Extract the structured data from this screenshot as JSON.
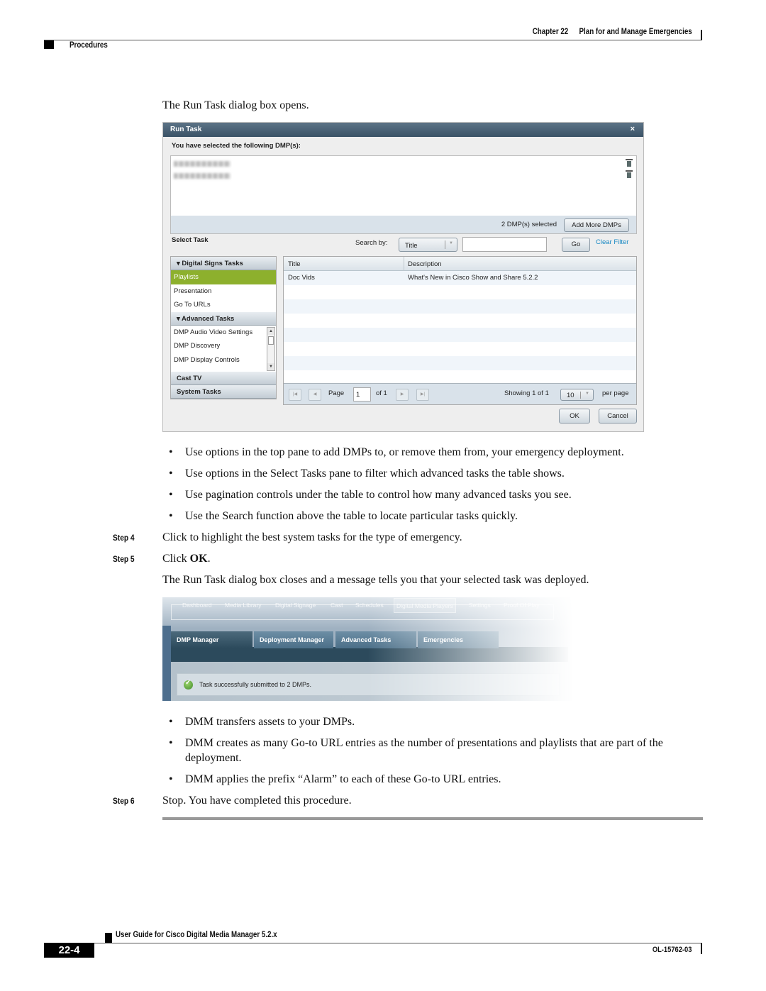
{
  "header": {
    "chapter_number": "Chapter 22",
    "chapter_title": "Plan for and Manage Emergencies",
    "section": "Procedures"
  },
  "intro_text": "The Run Task dialog box opens.",
  "run_task_dialog": {
    "title": "Run Task",
    "close_icon": "×",
    "selected_label": "You have selected the following DMP(s):",
    "dmps_count_text": "2 DMP(s) selected",
    "add_more_label": "Add More DMPs",
    "select_task_label": "Select Task",
    "search_by_label": "Search by:",
    "search_by_value": "Title",
    "search_input_value": "",
    "go_label": "Go",
    "clear_filter_label": "Clear Filter",
    "tree": {
      "group1": "▾ Digital Signs Tasks",
      "group1_items": [
        "Playlists",
        "Presentation",
        "Go To URLs"
      ],
      "group2": "▾ Advanced Tasks",
      "group2_items": [
        "DMP Audio Video Settings",
        "DMP Discovery",
        "DMP Display Controls"
      ],
      "group3": "Cast TV",
      "group4": "System Tasks"
    },
    "grid": {
      "columns": [
        "Title",
        "Description"
      ],
      "rows": [
        {
          "title": "Doc Vids",
          "description": "What's New in Cisco Show and Share 5.2.2"
        }
      ]
    },
    "pager": {
      "page_label": "Page",
      "page_value": "1",
      "of_label": "of 1",
      "showing_label": "Showing 1 of 1",
      "per_page_value": "10",
      "per_page_label": "per page"
    },
    "ok_label": "OK",
    "cancel_label": "Cancel",
    "accent_color": "#8db02d",
    "link_color": "#1a8ac4"
  },
  "bullets_1": [
    "Use options in the top pane to add DMPs to, or remove them from, your emergency deployment.",
    "Use options in the Select Tasks pane to filter which advanced tasks the table shows.",
    "Use pagination controls under the table to control how many advanced tasks you see.",
    "Use the Search function above the table to locate particular tasks quickly."
  ],
  "steps": {
    "step4_label": "Step 4",
    "step4_text": "Click to highlight the best system tasks for the type of emergency.",
    "step5_label": "Step 5",
    "step5_text_prefix": "Click ",
    "step5_text_bold": "OK",
    "step5_text_suffix": ".",
    "step5_result": "The Run Task dialog box closes and a message tells you that your selected task was deployed.",
    "step6_label": "Step 6",
    "step6_text": "Stop. You have completed this procedure."
  },
  "status_screenshot": {
    "nav_items": [
      "Dashboard",
      "Media Library",
      "Digital Signage",
      "Cast",
      "Schedules",
      "Digital Media Players",
      "Settings",
      "Proof Of Play"
    ],
    "tabs": [
      "DMP Manager",
      "Deployment Manager",
      "Advanced Tasks",
      "Emergencies"
    ],
    "message": "Task successfully submitted to 2 DMPs."
  },
  "bullets_2": [
    "DMM transfers assets to your DMPs.",
    "DMM creates as many Go-to URL entries as the number of presentations and playlists that are part of the deployment.",
    "DMM applies the prefix “Alarm” to each of these Go-to URL entries."
  ],
  "footer": {
    "guide_title": "User Guide for Cisco Digital Media Manager 5.2.x",
    "page_number": "22-4",
    "doc_number": "OL-15762-03"
  }
}
